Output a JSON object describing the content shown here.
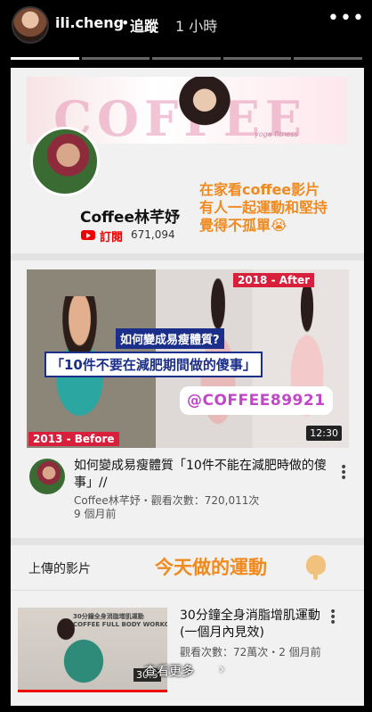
{
  "header": {
    "username": "ili.cheng",
    "separator": "•",
    "follow_label": "追蹤",
    "time_ago": "1 小時",
    "more_icon": "more-horizontal-icon"
  },
  "story_progress": {
    "segments": 5,
    "active_index": 0
  },
  "card": {
    "banner": {
      "title": "COFFEE",
      "subtitle": "yoga fitness"
    },
    "channel_name": "Coffee林芊妤",
    "subscribe_label": "訂閱",
    "subscriber_count": "671,094",
    "overlay_text": "在家看coffee影片\n有人一起運動和堅持\n覺得不孤單😭",
    "featured_video": {
      "thumbnail": {
        "tag_after": "2018 - After",
        "tag_before": "2013 - Before",
        "question": "如何變成易瘦體質?",
        "headline": "「10件不要在減肥期間做的傻事」",
        "handle": "@COFFEE89921",
        "duration": "12:30"
      },
      "title": "如何變成易瘦體質「10件不能在減肥時做的傻事」//",
      "meta": "Coffee林芊妤・觀看次數：720,011次\n9 個月前"
    },
    "uploads_label": "上傳的影片",
    "today_label": "今天做的運動",
    "second_video": {
      "thumbnail_caption": "30分鐘全身消脂增肌運動\nCOFFEE FULL BODY WORKOUT",
      "duration": "30:5",
      "title": "30分鐘全身消脂增肌運動 (一個月內見效)",
      "meta": "觀看次數：72萬次・2 個月前"
    }
  },
  "see_more": {
    "label": "查看更多",
    "arrow": "›"
  }
}
